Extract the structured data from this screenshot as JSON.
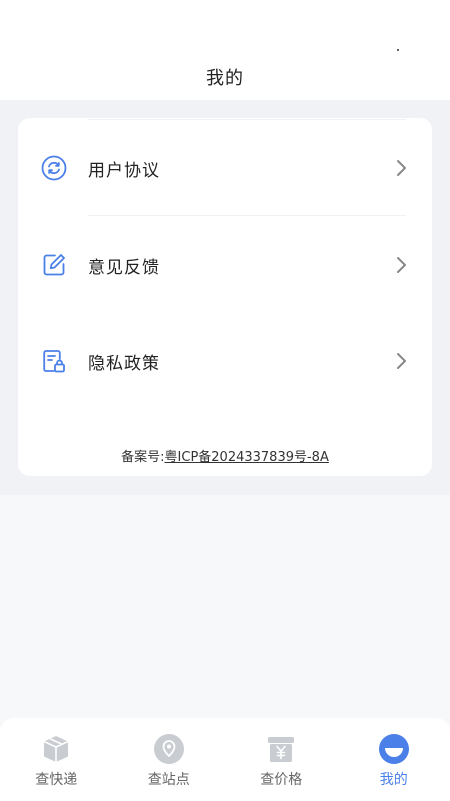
{
  "header": {
    "title": "我的"
  },
  "menu": {
    "items": [
      {
        "label": "用户协议",
        "icon": "refresh-circle-icon"
      },
      {
        "label": "意见反馈",
        "icon": "edit-icon"
      },
      {
        "label": "隐私政策",
        "icon": "document-lock-icon"
      }
    ]
  },
  "footer": {
    "icp_prefix": "备案号:",
    "icp_number": "粤ICP备2024337839号-8A"
  },
  "tabbar": {
    "tabs": [
      {
        "label": "查快递",
        "icon": "package-icon"
      },
      {
        "label": "查站点",
        "icon": "location-pin-icon"
      },
      {
        "label": "查价格",
        "icon": "price-tag-icon"
      },
      {
        "label": "我的",
        "icon": "profile-icon",
        "active": true
      }
    ]
  },
  "colors": {
    "accent": "#4a80e8",
    "inactive_icon": "#c9ccd1",
    "background": "#f7f8fa",
    "card": "#ffffff"
  }
}
